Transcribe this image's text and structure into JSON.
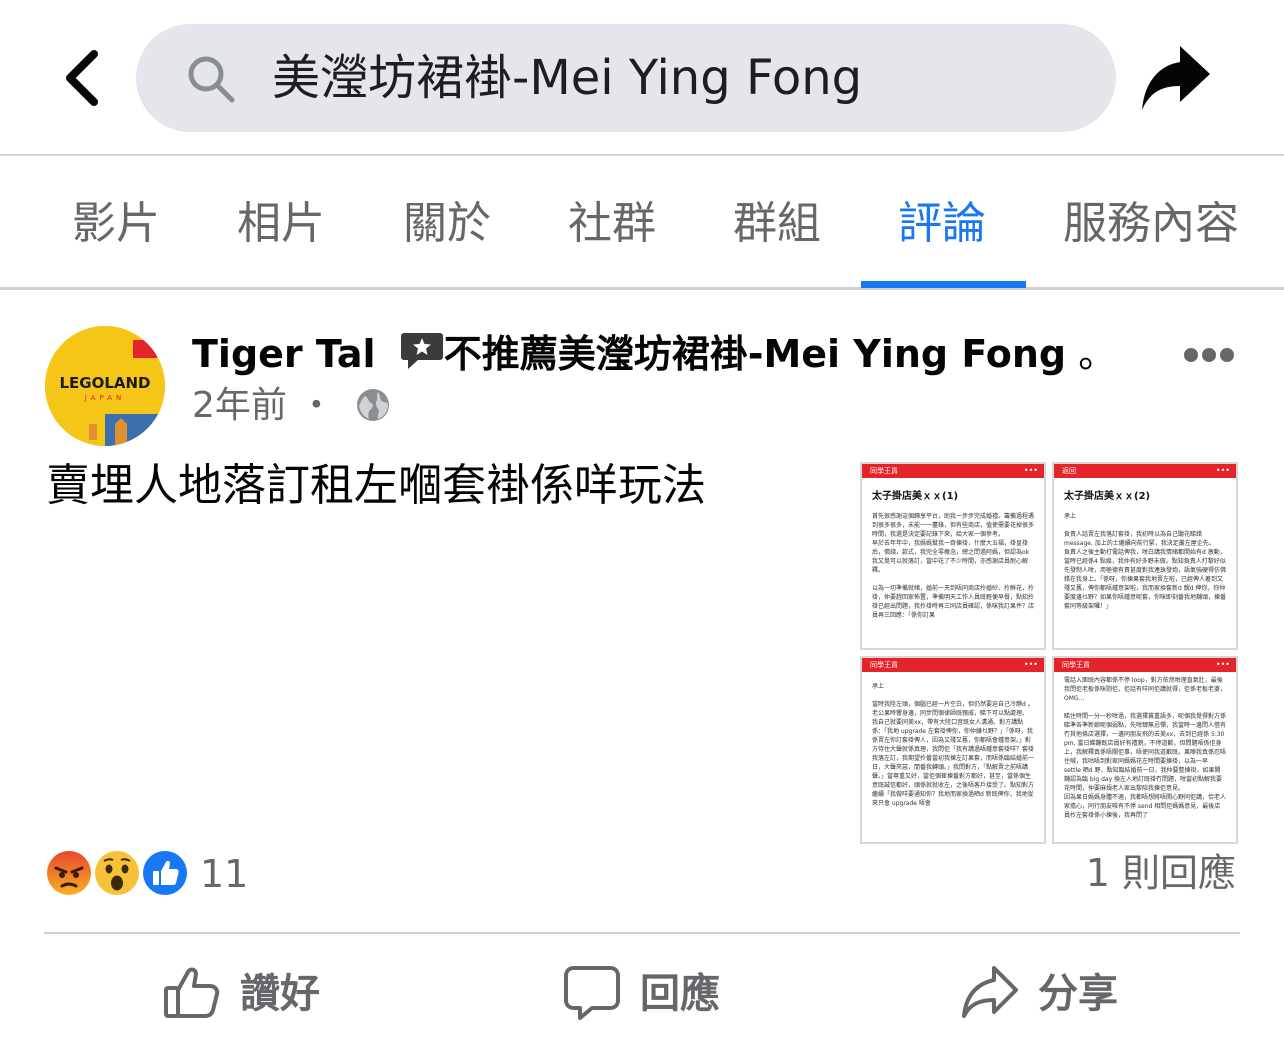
{
  "header": {
    "back_icon": "chevron-left-icon",
    "search_icon": "search-icon",
    "search_text": "美瀅坊裙褂-Mei Ying Fong",
    "share_icon": "share-arrow-icon"
  },
  "tabs": [
    {
      "label": "影片",
      "active": false
    },
    {
      "label": "相片",
      "active": false
    },
    {
      "label": "關於",
      "active": false
    },
    {
      "label": "社群",
      "active": false
    },
    {
      "label": "群組",
      "active": false
    },
    {
      "label": "評論",
      "active": true
    },
    {
      "label": "服務內容",
      "active": false
    }
  ],
  "post": {
    "avatar_text": "LEGOLAND",
    "avatar_subtext": "JAPAN",
    "author": "Tiger Tal",
    "recommend_text": "不推薦美瀅坊裙褂-Mei Ying Fong",
    "recommend_suffix": " 。",
    "time": "2年前",
    "separator": "・",
    "privacy_icon": "globe-icon",
    "body": "賣埋人地落訂租左嗰套褂係咩玩法",
    "photos": [
      {
        "bar": "同學王貢",
        "title": "太子掛店美ｘｘ(1)",
        "body": "首先很感謝這個歸享平台，助我一步步完成婚禮。籌備過程遇到很多很多，未能一一盡錄，但有些商店，值使需要花掉很多時間，我還是決定要記錄下來，給大家一個參考。\n早於去年年中，我媽媽幫我一齊揀褂，什麼大五福，褂皇褂后，價錢，款式，我完全零概念，總之問過阿媽，但認為ok 我又覺可以就落訂，當中花了不少時間，亦感謝店員耐心解釋。\n\n以為一切準備就緒，婚前一天到唔同商店拎婚紗、拎鮮花，拎褂，仲要趕回家佈置，準備明天工作人員既輕便早餐，點知拎褂已經出問題，我拎褂時再三同店員確認，係咪我訂果件？店員再三回應：「係你訂果"
      },
      {
        "bar": "返回",
        "title": "太子掛店美ｘｘ(2)",
        "body": "承上\n\n負責人話賣左我落訂套褂，我初時以為自己聽花睇錯message, 加上的士繼續向前行緊，我決定叢左屋企先。\n負責人之後主動打電話俾我，咁白講我情緒都開始有d 激動，當時已經係4 點幾，我仲有好多野未做。點知負責人打黎好似先發制人咁，用極德有責甚度對我連珠發炮，語氣強硬得仿佛錯在我身上。「係呀，你揀果套我地賣左啦，已經俾人著到又殘又舊，俾你都唔鍾意架啦，我而家換套新d 靚d 俾你，你仲要度邊乜野？如果你唔鍾意呢套，你咪即刻番我地舖頭，揀番套同等級架囉！」"
      },
      {
        "bar": "同學王貢",
        "title": "",
        "body": "承上\n\n當時我陸左頭，個腦已經一片空白，但仍然要迫自己冷靜d 。老公果時響身邊，同步問個律師既親戚，睇下可以點處理。\n我自己就要同美xx，帶有大陸口音既女人溝通。對方講點係：「我地 upgrade 左套褂俾你，你仲嫌乜野？」「係呀，我係賣左你訂套褂俾人，因為又殘又舊，你都唔會鍾意架。」對方侍住大聲就係真理，我問佢「我有講過唔鍾意套褂咩？套褂我落左訂，我期望拎番當初我揀左訂果套，而唔係臨結婚前一日，大聲夾惡，閒番我轉頭。」我問對方，「點解賣之前唔講聲。」當尊重又好，當佢個崔揀番對方都好，甚至，當係個生意既誠信都好，頭係就就收左，之後唔客戶接受了。點知對方繼續「我做咩要通知你？我地而家換過晒d 新既俾你，我地從來只會 upgrade 唔會"
      },
      {
        "bar": "同學王貢",
        "title": "",
        "body": "電話入面既內容都係不停 loop，對方依然咁理直氣壯，最後我問佢老板係咪剔佢，佢話有咩同佢講就得，佢係老板老婆，OMG...\n\n睇住時間一分一秒咁過，我選擇冀重語多，呢個我覺得對方係睇準各準新娘呢個弱點，先咁肆無忌憚，我當時一邊問人借有冇其他條店選擇，一邊同朋友飛的去美xx，去到已經係 5:30 pm, 當日睇舖既店員好有禮貌，不停道歉，但問題唔係佢身上，我解釋真係唔關佢事，唔使同我道歉既。果陣我真係忍唔住喊，我咕唔到對家同媽媽花左時間要揀褂，以為一早 settle 晒d 野，點知臨結婚前一日，我仲要整揀褂，如果開舖認為臨 big day 換左人地訂既褂冇問題，咁當初點解我要花時間，仲要麻煩老人家出黎陪我揀佢意見。\n因為果日媽媽身體不適，我都唔想將唔開心野同佢講，恰老人家擔心，同行朋友唯有不停 send 相問佢媽媽意見，最後店員拎左套褂係小揀後，我再問了"
      }
    ]
  },
  "reactions": {
    "icons": [
      "angry-reaction-icon",
      "wow-reaction-icon",
      "like-reaction-icon"
    ],
    "count": "11",
    "comments": "1 則回應"
  },
  "actions": [
    {
      "label": "讚好",
      "icon": "thumbs-up-icon"
    },
    {
      "label": "回應",
      "icon": "comment-icon"
    },
    {
      "label": "分享",
      "icon": "share-icon"
    }
  ],
  "colors": {
    "accent": "#1877f2",
    "muted": "#65676b",
    "search_bg": "#e4e6eb",
    "photo_bar": "#e3242b"
  }
}
